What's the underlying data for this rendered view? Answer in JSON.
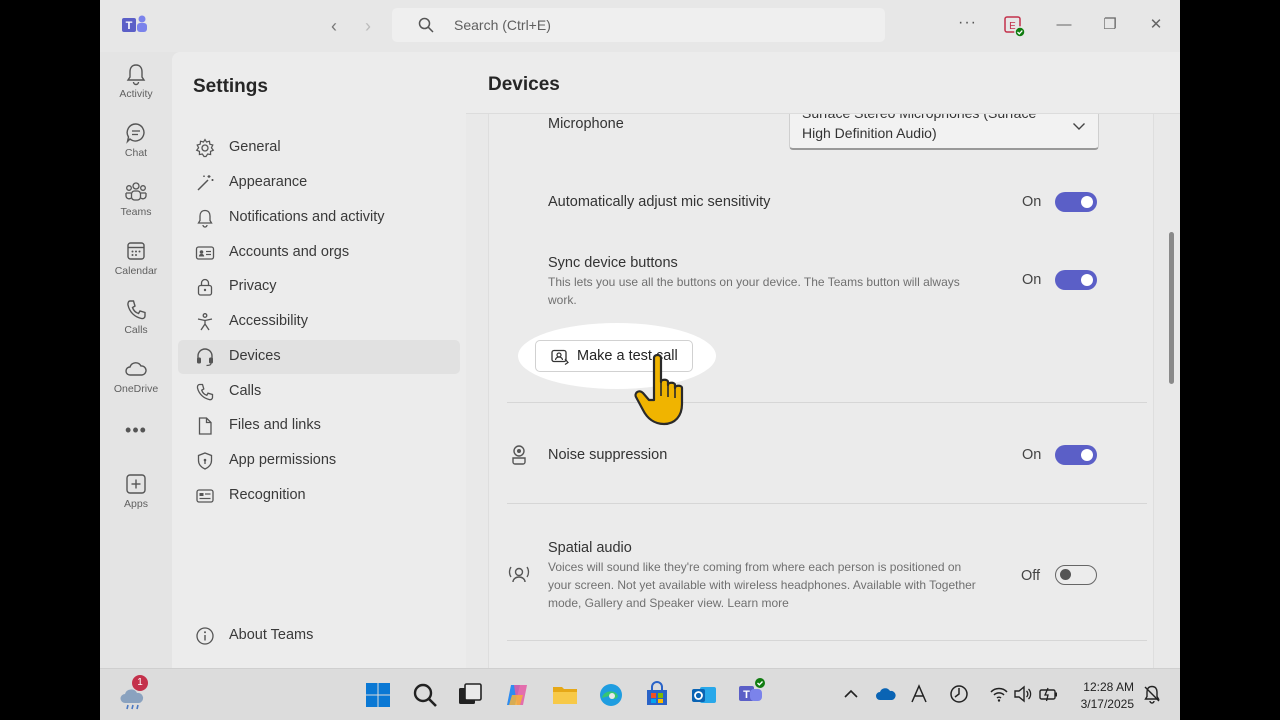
{
  "titlebar": {
    "search_placeholder": "Search (Ctrl+E)",
    "back_glyph": "‹",
    "forward_glyph": "›",
    "more_glyph": "···",
    "minimize_glyph": "—",
    "restore_glyph": "❐",
    "close_glyph": "✕"
  },
  "rail": {
    "items": [
      {
        "label": "Activity",
        "icon": "bell-icon"
      },
      {
        "label": "Chat",
        "icon": "chat-icon"
      },
      {
        "label": "Teams",
        "icon": "teams-icon"
      },
      {
        "label": "Calendar",
        "icon": "calendar-icon"
      },
      {
        "label": "Calls",
        "icon": "phone-icon"
      },
      {
        "label": "OneDrive",
        "icon": "cloud-icon"
      }
    ],
    "more_glyph": "•••",
    "apps_label": "Apps"
  },
  "settings": {
    "title": "Settings",
    "items": [
      {
        "label": "General",
        "icon": "gear-icon"
      },
      {
        "label": "Appearance",
        "icon": "wand-icon"
      },
      {
        "label": "Notifications and activity",
        "icon": "bell-icon"
      },
      {
        "label": "Accounts and orgs",
        "icon": "id-card-icon"
      },
      {
        "label": "Privacy",
        "icon": "lock-icon"
      },
      {
        "label": "Accessibility",
        "icon": "accessibility-icon"
      },
      {
        "label": "Devices",
        "icon": "headset-icon"
      },
      {
        "label": "Calls",
        "icon": "phone-icon"
      },
      {
        "label": "Files and links",
        "icon": "file-icon"
      },
      {
        "label": "App permissions",
        "icon": "shield-icon"
      },
      {
        "label": "Recognition",
        "icon": "recognition-icon"
      }
    ],
    "active": "Devices",
    "about": "About Teams"
  },
  "devices": {
    "title": "Devices",
    "microphone": {
      "label": "Microphone",
      "value_line1": "Surface Stereo Microphones (Surface",
      "value_line2": "High Definition Audio)"
    },
    "auto_mic": {
      "label": "Automatically adjust mic sensitivity",
      "state": "On"
    },
    "sync_buttons": {
      "label": "Sync device buttons",
      "desc_line1": "This lets you use all the buttons on your device. The Teams button will always",
      "desc_line2": "work.",
      "state": "On"
    },
    "test_call": {
      "label": "Make a test call"
    },
    "noise": {
      "label": "Noise suppression",
      "state": "On"
    },
    "spatial": {
      "label": "Spatial audio",
      "desc_line1": "Voices will sound like they're coming from where each person is positioned on",
      "desc_line2": "your screen. Not yet available with wireless headphones. Available with Together",
      "desc_line3": "mode, Gallery and Speaker view. Learn more",
      "state": "Off"
    }
  },
  "taskbar": {
    "notification_count": "1",
    "time": "12:28 AM",
    "date": "3/17/2025"
  },
  "colors": {
    "accent": "#5b5fc7",
    "cursor": "#f0b400"
  }
}
